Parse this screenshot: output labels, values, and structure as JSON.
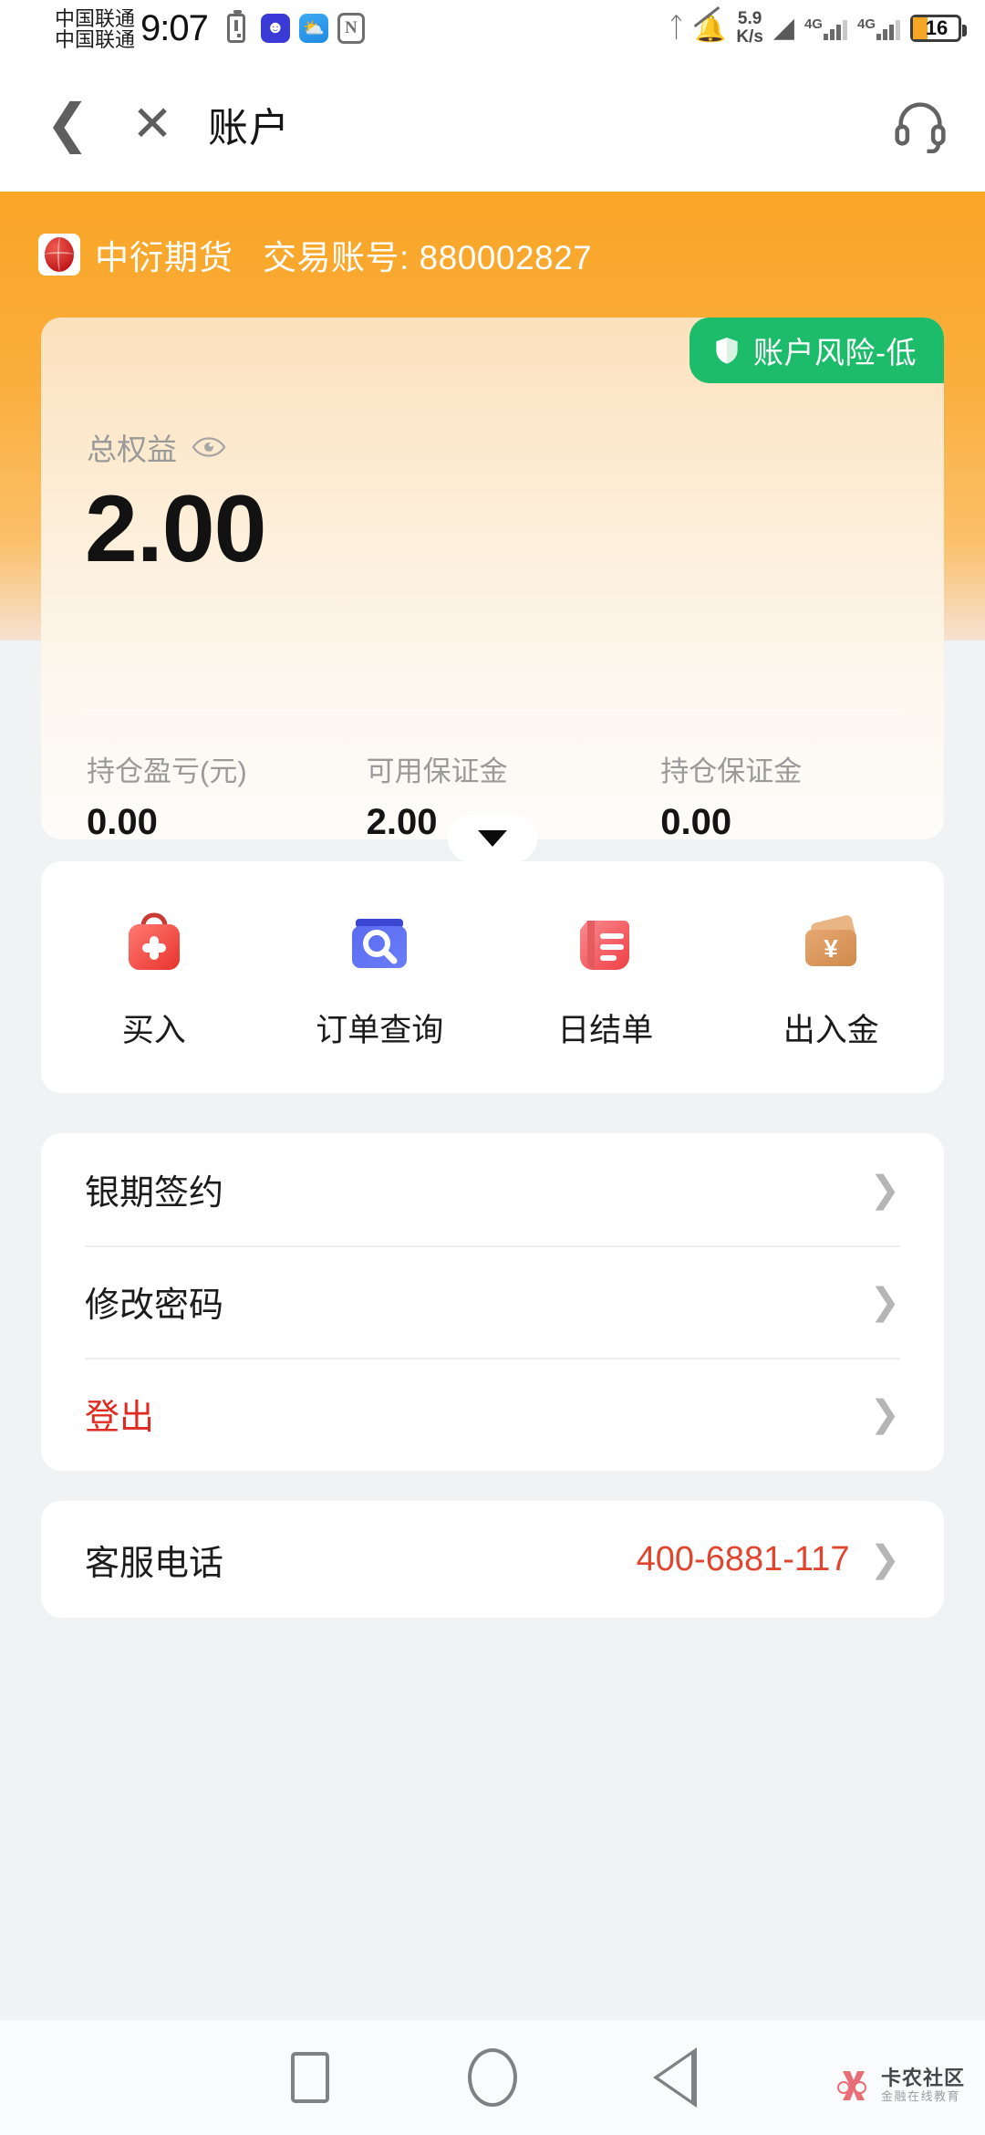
{
  "status_bar": {
    "carrier_line1": "中国联通",
    "carrier_line2": "中国联通",
    "time": "9:07",
    "net_speed_value": "5.9",
    "net_speed_unit": "K/s",
    "battery_percent": "16",
    "network_label_1": "4G",
    "network_label_2": "4G",
    "icons": [
      "battery-alert-icon",
      "qq-icon",
      "weather-icon",
      "nfc-icon",
      "bluetooth-icon",
      "mute-bell-icon",
      "wifi-icon",
      "signal-icon",
      "battery-icon"
    ]
  },
  "header": {
    "back_icon": "chevron-left-icon",
    "close_icon": "close-icon",
    "title": "账户",
    "support_icon": "headset-icon"
  },
  "banner": {
    "brand_name": "中衍期货",
    "account_label": "交易账号: 880002827",
    "logo_icon": "brand-globe-icon",
    "accent_color": "#f9a526"
  },
  "equity_card": {
    "risk_badge": {
      "text": "账户风险-低",
      "icon": "shield-icon",
      "color": "#1dbc6b"
    },
    "equity_label": "总权益",
    "eye_icon": "eye-icon",
    "equity_value": "2.00",
    "stats": [
      {
        "label": "持仓盈亏(元)",
        "value": "0.00"
      },
      {
        "label": "可用保证金",
        "value": "2.00"
      },
      {
        "label": "持仓保证金",
        "value": "0.00"
      }
    ],
    "expand_icon": "chevron-down-icon"
  },
  "actions": [
    {
      "label": "买入",
      "icon": "buy-bag-icon",
      "color": "#f0564f"
    },
    {
      "label": "订单查询",
      "icon": "order-search-icon",
      "color": "#5566ee"
    },
    {
      "label": "日结单",
      "icon": "daily-statement-icon",
      "color": "#f2575c"
    },
    {
      "label": "出入金",
      "icon": "wallet-yuan-icon",
      "color": "#dd9451"
    }
  ],
  "menu": [
    {
      "label": "银期签约",
      "chevron": "chevron-right-icon",
      "danger": false
    },
    {
      "label": "修改密码",
      "chevron": "chevron-right-icon",
      "danger": false
    },
    {
      "label": "登出",
      "chevron": "chevron-right-icon",
      "danger": true
    }
  ],
  "service": {
    "label": "客服电话",
    "value": "400-6881-117",
    "chevron": "chevron-right-icon",
    "value_color": "#e0462f"
  },
  "nav_bar": {
    "recents_icon": "square-recents-icon",
    "home_icon": "circle-home-icon",
    "back_icon": "triangle-back-icon"
  },
  "watermark": {
    "title": "卡农社区",
    "subtitle": "金融在线教育",
    "logo_icon": "kanong-logo-icon"
  }
}
